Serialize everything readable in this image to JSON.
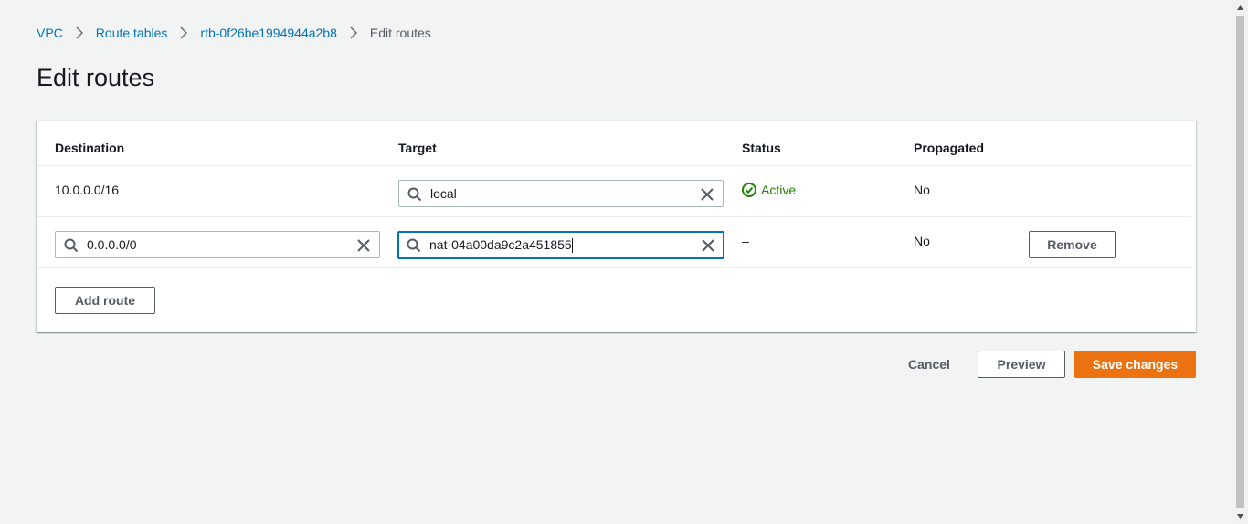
{
  "breadcrumb": {
    "items": [
      "VPC",
      "Route tables",
      "rtb-0f26be1994944a2b8"
    ],
    "current": "Edit routes"
  },
  "page": {
    "title": "Edit routes"
  },
  "table": {
    "headers": {
      "destination": "Destination",
      "target": "Target",
      "status": "Status",
      "propagated": "Propagated"
    },
    "rows": [
      {
        "destination": "10.0.0.0/16",
        "target": "local",
        "status": "Active",
        "propagated": "No"
      },
      {
        "destination": "0.0.0.0/0",
        "target": "nat-04a00da9c2a451855",
        "status": "–",
        "propagated": "No",
        "remove_label": "Remove"
      }
    ],
    "add_route_label": "Add route"
  },
  "footer": {
    "cancel_label": "Cancel",
    "preview_label": "Preview",
    "save_label": "Save changes"
  },
  "colors": {
    "link": "#0073bb",
    "primary": "#ec7211",
    "success": "#1d8102",
    "focus": "#0073bb"
  }
}
